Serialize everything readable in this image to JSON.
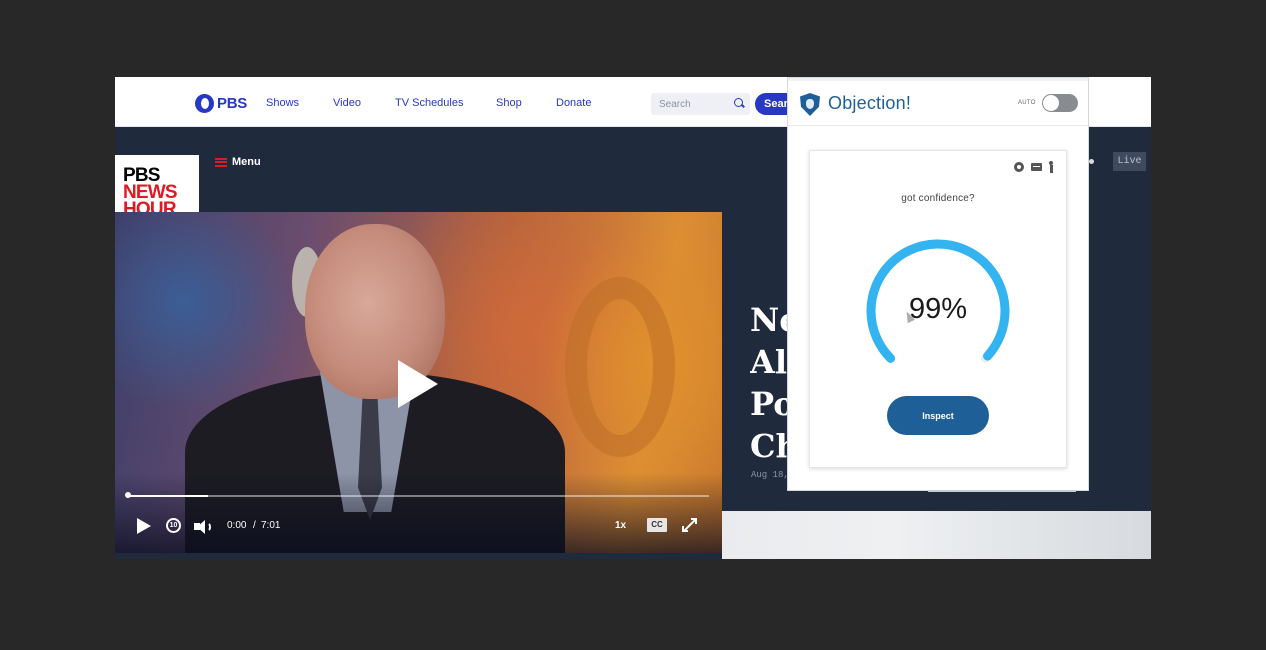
{
  "nav": {
    "logo_text": "PBS",
    "links": [
      "Shows",
      "Video",
      "TV Schedules",
      "Shop",
      "Donate"
    ],
    "search_placeholder": "Search",
    "search_button": "Search"
  },
  "newshour": {
    "logo_lines": [
      "PBS",
      "NEWS",
      "HOUR"
    ],
    "menu_label": "Menu",
    "live_badge": "Live",
    "headline_lines": [
      "Ne",
      "Al",
      "Po",
      "Ch"
    ],
    "date": "Aug 18,"
  },
  "video": {
    "time_current": "0:00",
    "time_separator": "/",
    "time_total": "7:01",
    "speed": "1x",
    "cc": "CC",
    "replay_label": "10",
    "progress_fraction": 0.14
  },
  "extension": {
    "title": "Objection!",
    "auto_label": "AUTO",
    "auto_enabled": false,
    "prompt": "got confidence?",
    "confidence_percent": 99,
    "confidence_text": "99%",
    "inspect_label": "Inspect",
    "header_icons": [
      "github-icon",
      "keyboard-icon",
      "accessibility-icon"
    ],
    "colors": {
      "accent": "#1f5f97",
      "gauge": "#33b3ef"
    }
  }
}
